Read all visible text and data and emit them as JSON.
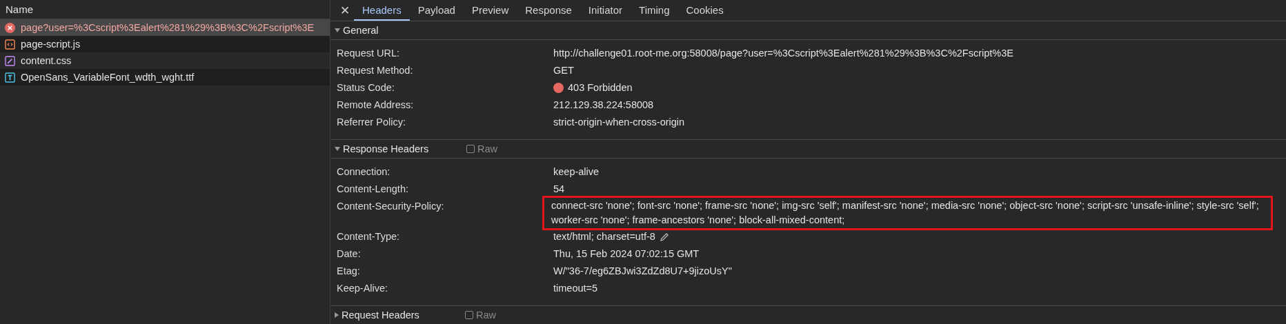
{
  "request_list": {
    "column_header": "Name",
    "requests": [
      {
        "name": "page?user=%3Cscript%3Ealert%281%29%3B%3C%2Fscript%3E",
        "kind": "error",
        "selected": true
      },
      {
        "name": "page-script.js",
        "kind": "script",
        "selected": false
      },
      {
        "name": "content.css",
        "kind": "stylesheet",
        "selected": false
      },
      {
        "name": "OpenSans_VariableFont_wdth_wght.ttf",
        "kind": "font",
        "selected": false
      }
    ]
  },
  "close_label": "✕",
  "tabs": [
    {
      "label": "Headers",
      "selected": true
    },
    {
      "label": "Payload",
      "selected": false
    },
    {
      "label": "Preview",
      "selected": false
    },
    {
      "label": "Response",
      "selected": false
    },
    {
      "label": "Initiator",
      "selected": false
    },
    {
      "label": "Timing",
      "selected": false
    },
    {
      "label": "Cookies",
      "selected": false
    }
  ],
  "sections": [
    {
      "title": "General",
      "expanded": true,
      "headers": [
        {
          "name": "Request URL:",
          "value": "http://challenge01.root-me.org:58008/page?user=%3Cscript%3Ealert%281%29%3B%3C%2Fscript%3E"
        },
        {
          "name": "Request Method:",
          "value": "GET"
        },
        {
          "name": "Status Code:",
          "value": "403 Forbidden",
          "color": "#e46962"
        },
        {
          "name": "Remote Address:",
          "value": "212.129.38.224:58008"
        },
        {
          "name": "Referrer Policy:",
          "value": "strict-origin-when-cross-origin"
        }
      ]
    },
    {
      "title": "Response Headers",
      "expanded": true,
      "raw_label": "Raw",
      "raw_checked": false,
      "headers": [
        {
          "name": "Connection:",
          "value": "keep-alive"
        },
        {
          "name": "Content-Length:",
          "value": "54"
        },
        {
          "name": "Content-Security-Policy:",
          "value": "connect-src 'none'; font-src 'none'; frame-src 'none'; img-src 'self'; manifest-src 'none'; media-src 'none'; object-src 'none'; script-src 'unsafe-inline'; style-src 'self'; worker-src 'none'; frame-ancestors 'none'; block-all-mixed-content;",
          "highlighted": true
        },
        {
          "name": "Content-Type:",
          "value": "text/html; charset=utf-8",
          "editable": true
        },
        {
          "name": "Date:",
          "value": "Thu, 15 Feb 2024 07:02:15 GMT"
        },
        {
          "name": "Etag:",
          "value": "W/\"36-7/eg6ZBJwi3ZdZd8U7+9jizoUsY\""
        },
        {
          "name": "Keep-Alive:",
          "value": "timeout=5"
        }
      ]
    },
    {
      "title": "Request Headers",
      "expanded": false,
      "raw_label": "Raw",
      "raw_checked": false
    }
  ]
}
